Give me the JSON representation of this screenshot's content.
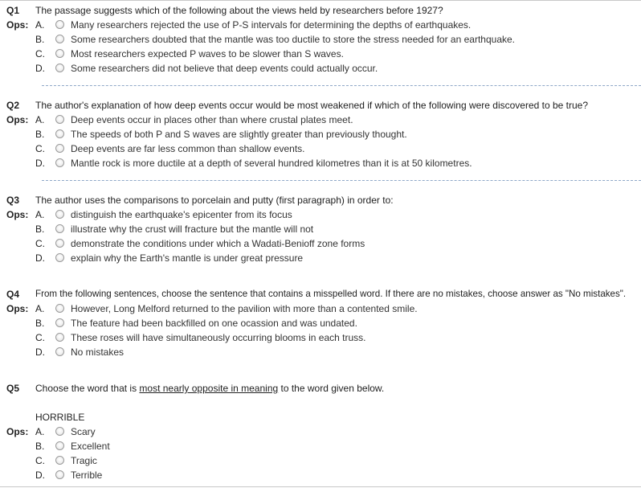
{
  "ops_label": "Ops:",
  "questions": [
    {
      "number": "Q1",
      "text": "The passage suggests which of the following about the views held by researchers before 1927?",
      "options": [
        {
          "letter": "A.",
          "text": "Many researchers rejected the use of P-S intervals for determining the depths of earthquakes."
        },
        {
          "letter": "B.",
          "text": "Some researchers doubted that the mantle was too ductile to store the stress needed for an earthquake."
        },
        {
          "letter": "C.",
          "text": "Most researchers expected P waves to be slower than S waves."
        },
        {
          "letter": "D.",
          "text": "Some researchers did not believe that deep events could actually occur."
        }
      ]
    },
    {
      "number": "Q2",
      "text": "The author's explanation of how deep events occur would be most weakened if which of the following were discovered to be true?",
      "options": [
        {
          "letter": "A.",
          "text": "Deep events occur in places other than where crustal plates meet."
        },
        {
          "letter": "B.",
          "text": "The speeds of both P and S waves are slightly greater than previously thought."
        },
        {
          "letter": "C.",
          "text": "Deep events are far less common than shallow events."
        },
        {
          "letter": "D.",
          "text": "Mantle rock is more ductile at a depth of several hundred kilometres than it is at 50 kilometres."
        }
      ]
    },
    {
      "number": "Q3",
      "text": "The author uses the comparisons to porcelain and putty (first paragraph) in order to:",
      "options": [
        {
          "letter": "A.",
          "text": "distinguish the earthquake's epicenter from its focus"
        },
        {
          "letter": "B.",
          "text": "illustrate why the crust will fracture but the mantle will not"
        },
        {
          "letter": "C.",
          "text": "demonstrate the conditions under which a Wadati-Benioff zone forms"
        },
        {
          "letter": "D.",
          "text": "explain why the Earth's mantle is under great pressure"
        }
      ]
    },
    {
      "number": "Q4",
      "text": "From the following sentences, choose the sentence that contains a misspelled word. If there are no mistakes, choose answer as \"No mistakes\".",
      "options": [
        {
          "letter": "A.",
          "text": "However, Long Melford returned to the pavilion with more than a contented smile."
        },
        {
          "letter": "B.",
          "text": "The feature had been backfilled on one ocassion and was undated."
        },
        {
          "letter": "C.",
          "text": "These roses will have simultaneously occurring blooms in each truss."
        },
        {
          "letter": "D.",
          "text": "No mistakes"
        }
      ]
    },
    {
      "number": "Q5",
      "text_before": "Choose the word that is ",
      "text_underlined": "most nearly opposite in meaning",
      "text_after": " to the word given below.",
      "word": "HORRIBLE",
      "options": [
        {
          "letter": "A.",
          "text": "Scary"
        },
        {
          "letter": "B.",
          "text": "Excellent"
        },
        {
          "letter": "C.",
          "text": "Tragic"
        },
        {
          "letter": "D.",
          "text": "Terrible"
        }
      ]
    }
  ]
}
